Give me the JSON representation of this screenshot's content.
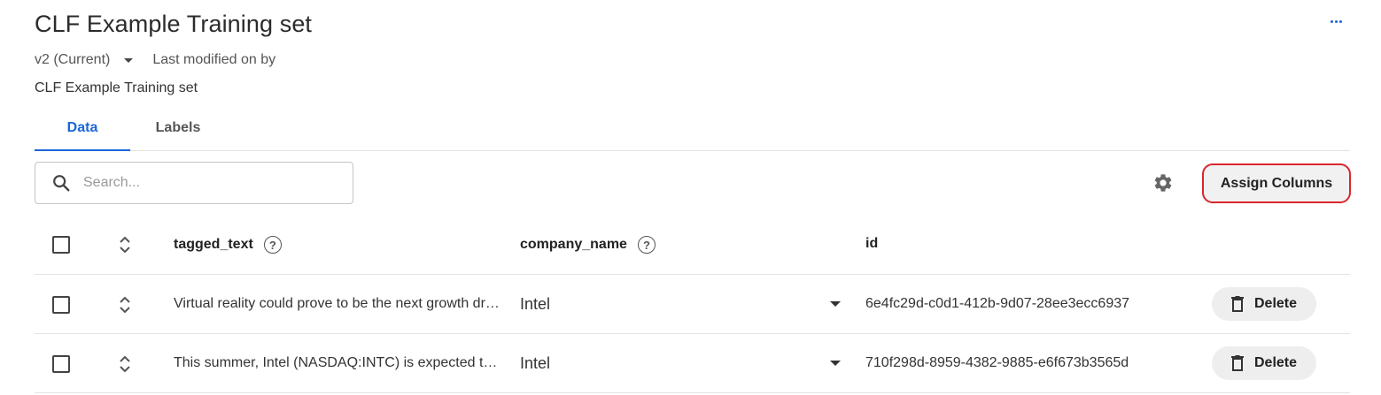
{
  "header": {
    "title": "CLF Example Training set",
    "more_icon": "more-horizontal-icon",
    "version_label": "v2 (Current)",
    "last_modified": "Last modified on by",
    "subtitle": "CLF Example Training set"
  },
  "tabs": [
    {
      "label": "Data",
      "active": true
    },
    {
      "label": "Labels",
      "active": false
    }
  ],
  "toolbar": {
    "search_placeholder": "Search...",
    "search_value": "",
    "settings_icon": "gear-icon",
    "assign_columns_label": "Assign Columns"
  },
  "table": {
    "columns": [
      "tagged_text",
      "company_name",
      "id"
    ],
    "rows": [
      {
        "tagged_text": "Virtual reality could prove to be the next growth driver for Intel",
        "company_name": "Intel",
        "id": "6e4fc29d-c0d1-412b-9d07-28ee3ecc6937",
        "delete_label": "Delete"
      },
      {
        "tagged_text": "This summer, Intel (NASDAQ:INTC) is expected to launch",
        "company_name": "Intel",
        "id": "710f298d-8959-4382-9885-e6f673b3565d",
        "delete_label": "Delete"
      }
    ]
  },
  "colors": {
    "accent": "#1a66d9",
    "highlight_border": "#d9262c"
  }
}
